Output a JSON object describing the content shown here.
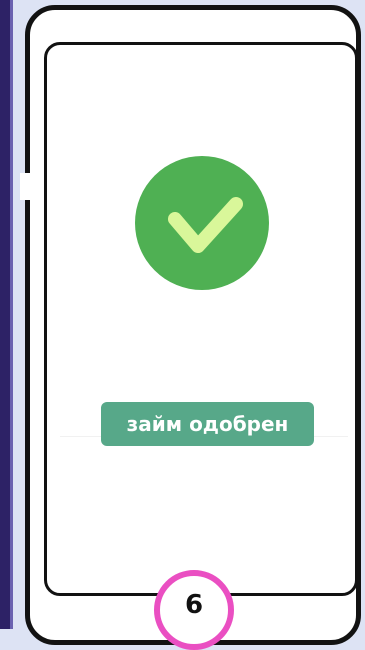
{
  "status": {
    "label": "займ одобрен"
  },
  "step": {
    "number": "6"
  },
  "icons": {
    "status": "check-icon"
  },
  "colors": {
    "circle": "#4fb053",
    "check": "#d9f79a",
    "badge": "#57a889",
    "step_ring": "#ea4fc2"
  }
}
